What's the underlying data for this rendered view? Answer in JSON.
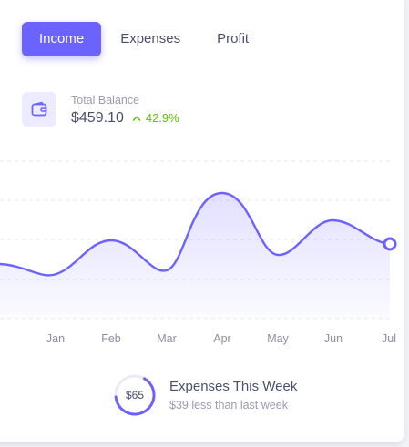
{
  "tabs": [
    {
      "label": "Income",
      "active": true
    },
    {
      "label": "Expenses",
      "active": false
    },
    {
      "label": "Profit",
      "active": false
    }
  ],
  "balance": {
    "icon": "wallet-icon",
    "label": "Total Balance",
    "amount": "$459.10",
    "change_icon": "chevron-up-icon",
    "change": "42.9%"
  },
  "colors": {
    "accent": "#6c63ff",
    "positive": "#56ca00",
    "text": "#4b4e6d",
    "muted": "#9a9cb0"
  },
  "chart_data": {
    "type": "area",
    "categories": [
      "Jan",
      "Feb",
      "Mar",
      "Apr",
      "May",
      "Jun",
      "Jul"
    ],
    "grid": true
  },
  "expenses": {
    "ring_value": "$65",
    "progress_percent": 65,
    "title": "Expenses This Week",
    "subtitle": "$39 less than last week"
  }
}
